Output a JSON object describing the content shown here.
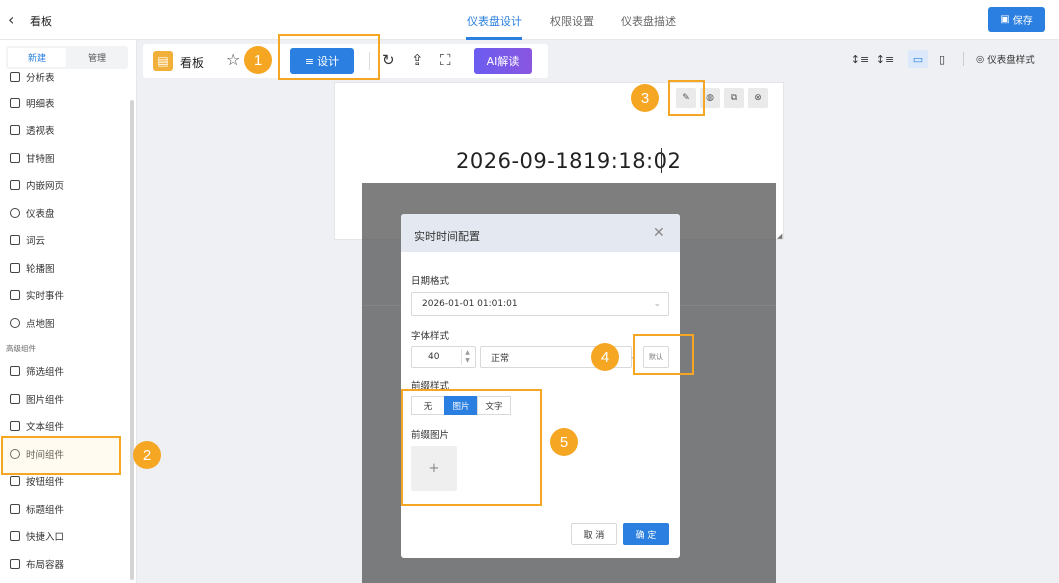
{
  "header": {
    "title": "看板",
    "tabs": [
      {
        "label": "仪表盘设计"
      },
      {
        "label": "权限设置"
      },
      {
        "label": "仪表盘描述"
      }
    ],
    "save_label": "保存"
  },
  "sidebar": {
    "tabs": [
      "新建",
      "管理"
    ],
    "items_top": [
      "分析表",
      "明细表",
      "透视表",
      "甘特图",
      "内嵌网页",
      "仪表盘",
      "词云",
      "轮播图",
      "实时事件",
      "点地图"
    ],
    "section_label": "高级组件",
    "items_adv": [
      "筛选组件",
      "图片组件",
      "文本组件",
      "时间组件",
      "按钮组件",
      "标题组件",
      "快捷入口",
      "布局容器"
    ]
  },
  "toolbar": {
    "board_label": "看板",
    "design_label": "设计",
    "ai_label": "AI解读",
    "dashboard_style_label": "仪表盘样式"
  },
  "canvas": {
    "time_text": "2026-09-1819:18:02"
  },
  "dialog": {
    "title": "实时时间配置",
    "date_format_label": "日期格式",
    "date_format_value": "2026-01-01 01:01:01",
    "font_style_label": "字体样式",
    "font_size": "40",
    "font_weight": "正常",
    "default_label": "默认",
    "prefix_style_label": "前缀样式",
    "prefix_options": [
      "无",
      "图片",
      "文字"
    ],
    "prefix_image_label": "前缀图片",
    "upload_symbol": "+",
    "cancel_label": "取 消",
    "ok_label": "确 定"
  },
  "markers": [
    "1",
    "2",
    "3",
    "4",
    "5"
  ],
  "colors": {
    "primary": "#2a7fe0",
    "highlight": "#f5a623",
    "ai_gradient_start": "#6a5cf0"
  }
}
